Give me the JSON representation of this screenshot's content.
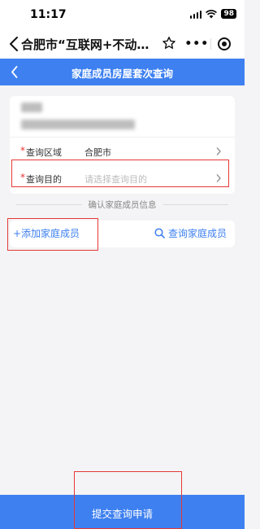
{
  "status": {
    "time": "11:17",
    "battery": "98"
  },
  "mini_program": {
    "title": "合肥市“互联网+不动…",
    "more": "•••"
  },
  "header": {
    "title": "家庭成员房屋套次查询"
  },
  "form": {
    "region": {
      "label": "查询区域",
      "value": "合肥市"
    },
    "purpose": {
      "label": "查询目的",
      "placeholder": "请选择查询目的"
    }
  },
  "divider": {
    "text": "确认家庭成员信息"
  },
  "actions": {
    "add_member": "+添加家庭成员",
    "query_member": "查询家庭成员"
  },
  "submit": {
    "label": "提交查询申请"
  },
  "colors": {
    "accent": "#3e80f0",
    "highlight": "#e53935",
    "required": "#e33333"
  }
}
